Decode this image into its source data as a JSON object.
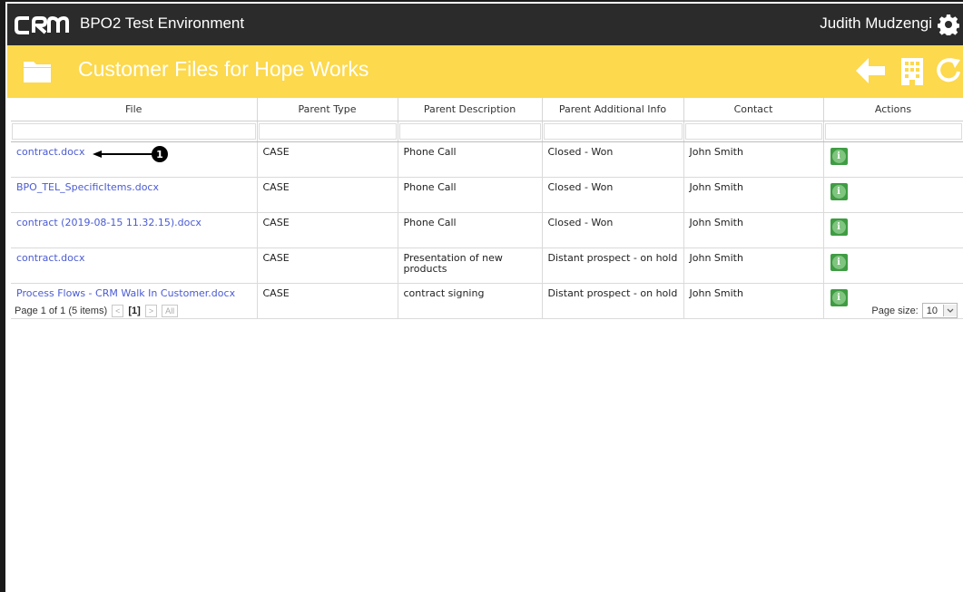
{
  "app": {
    "logo_text": "CRM",
    "environment": "BPO2 Test Environment",
    "user_name": "Judith Mudzengi",
    "icons": [
      "gear-icon",
      "folder-icon",
      "back-arrow-icon",
      "building-icon",
      "refresh-icon"
    ]
  },
  "page": {
    "title": "Customer Files for Hope Works"
  },
  "colors": {
    "topbar": "#2b2b2b",
    "header": "#fcd94d",
    "link": "#4a5bd4",
    "action": "#3f9c43"
  },
  "table": {
    "columns": [
      "File",
      "Parent Type",
      "Parent Description",
      "Parent Additional Info",
      "Contact",
      "Actions"
    ],
    "rows": [
      {
        "file": "contract.docx",
        "parent_type": "CASE",
        "parent_description": "Phone Call",
        "parent_additional_info": "Closed - Won",
        "contact": "John Smith"
      },
      {
        "file": "BPO_TEL_SpecificItems.docx",
        "parent_type": "CASE",
        "parent_description": "Phone Call",
        "parent_additional_info": "Closed - Won",
        "contact": "John Smith"
      },
      {
        "file": "contract (2019-08-15 11.32.15).docx",
        "parent_type": "CASE",
        "parent_description": "Phone Call",
        "parent_additional_info": "Closed - Won",
        "contact": "John Smith"
      },
      {
        "file": "contract.docx",
        "parent_type": "CASE",
        "parent_description": "Presentation of new products",
        "parent_additional_info": "Distant prospect - on hold",
        "contact": "John Smith"
      },
      {
        "file": "Process Flows - CRM Walk In Customer.docx",
        "parent_type": "CASE",
        "parent_description": "contract signing",
        "parent_additional_info": "Distant prospect - on hold",
        "contact": "John Smith"
      }
    ],
    "action_icon": "i"
  },
  "annotation": {
    "number": "1"
  },
  "pager": {
    "summary": "Page 1 of 1 (5 items)",
    "prev": "<",
    "current": "[1]",
    "next": ">",
    "all": "All",
    "page_size_label": "Page size:",
    "page_size_value": "10"
  }
}
